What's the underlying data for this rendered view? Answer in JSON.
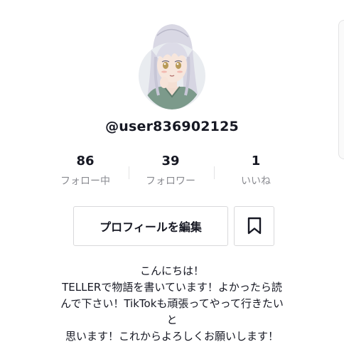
{
  "profile": {
    "username": "@user836902125",
    "avatar_icon": "anime-girl-avatar"
  },
  "stats": [
    {
      "value": "86",
      "label": "フォロー中"
    },
    {
      "value": "39",
      "label": "フォロワー"
    },
    {
      "value": "1",
      "label": "いいね"
    }
  ],
  "actions": {
    "edit_profile_label": "プロフィールを編集",
    "bookmark_icon": "bookmark-icon"
  },
  "bio": {
    "line1": "こんにちは！",
    "line2": "TELLERで物語を書いています！よかったら読",
    "line3": "んで下さい！TikTokも頑張ってやって行きたい",
    "line4": "と",
    "line5": "思います！これからよろしくお願いします！"
  }
}
